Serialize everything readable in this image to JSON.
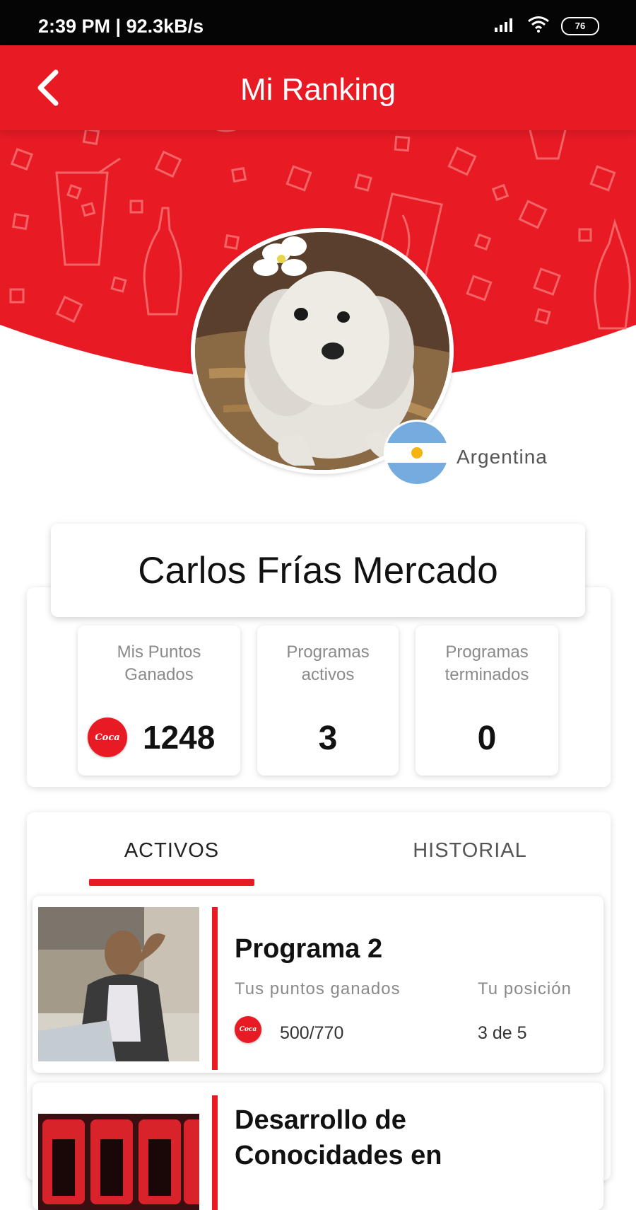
{
  "status_bar": {
    "time": "2:39 PM | 92.3kB/s",
    "battery": "76"
  },
  "header": {
    "title": "Mi Ranking",
    "back_icon": "chevron-left-icon"
  },
  "profile": {
    "name": "Carlos Frías Mercado",
    "country": "Argentina",
    "flag_icon": "argentina-flag-icon"
  },
  "stats": [
    {
      "label_line1": "Mis Puntos",
      "label_line2": "Ganados",
      "value": "1248",
      "icon": "coca-cola-badge-icon"
    },
    {
      "label_line1": "Programas",
      "label_line2": "activos",
      "value": "3"
    },
    {
      "label_line1": "Programas",
      "label_line2": "terminados",
      "value": "0"
    }
  ],
  "tabs": [
    {
      "label": "ACTIVOS",
      "active": true
    },
    {
      "label": "HISTORIAL",
      "active": false
    }
  ],
  "programs": [
    {
      "name": "Programa 2",
      "points_label": "Tus puntos ganados",
      "points_value": "500/770",
      "position_label": "Tu posición",
      "position_value": "3 de 5"
    },
    {
      "name_line1": "Desarrollo de",
      "name_line2": "Conocidades en"
    }
  ],
  "colors": {
    "brand_red": "#e81b25",
    "status_bar": "#050505"
  }
}
